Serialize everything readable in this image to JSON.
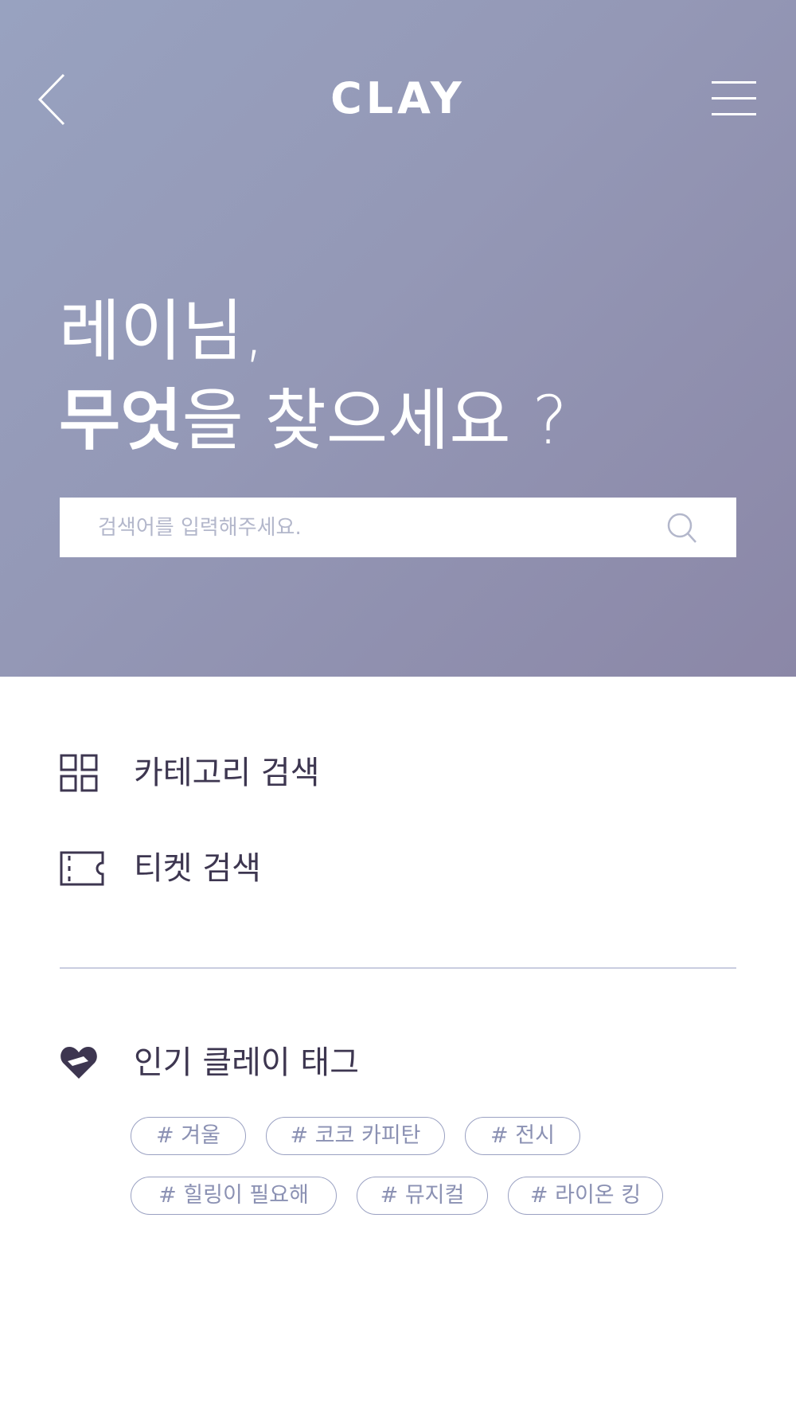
{
  "header": {
    "logo": "CLAY",
    "back_icon": "chevron-left-icon",
    "menu_icon": "hamburger-menu-icon"
  },
  "hero": {
    "greeting_line1": "레이님,",
    "greeting_bold": "무엇",
    "greeting_rest": "을 찾으세요 ?"
  },
  "search": {
    "placeholder": "검색어를 입력해주세요.",
    "icon": "search-icon"
  },
  "menu": {
    "category_label": "카테고리 검색",
    "category_icon": "grid-icon",
    "ticket_label": "티켓 검색",
    "ticket_icon": "ticket-icon"
  },
  "popular": {
    "title": "인기 클레이 태그",
    "icon": "heart-icon",
    "tags": [
      "# 겨울",
      "# 코코 카피탄",
      "# 전시",
      "# 힐링이 필요해",
      "# 뮤지컬",
      "# 라이온 킹"
    ]
  },
  "colors": {
    "hero_gradient_start": "#98a2c0",
    "hero_gradient_end": "#8b87a7",
    "text_dark": "#3d3650",
    "tag_text": "#8b91b3",
    "tag_border": "#9aa1c2",
    "divider": "#c9cde0",
    "placeholder": "#b3b7cb"
  }
}
